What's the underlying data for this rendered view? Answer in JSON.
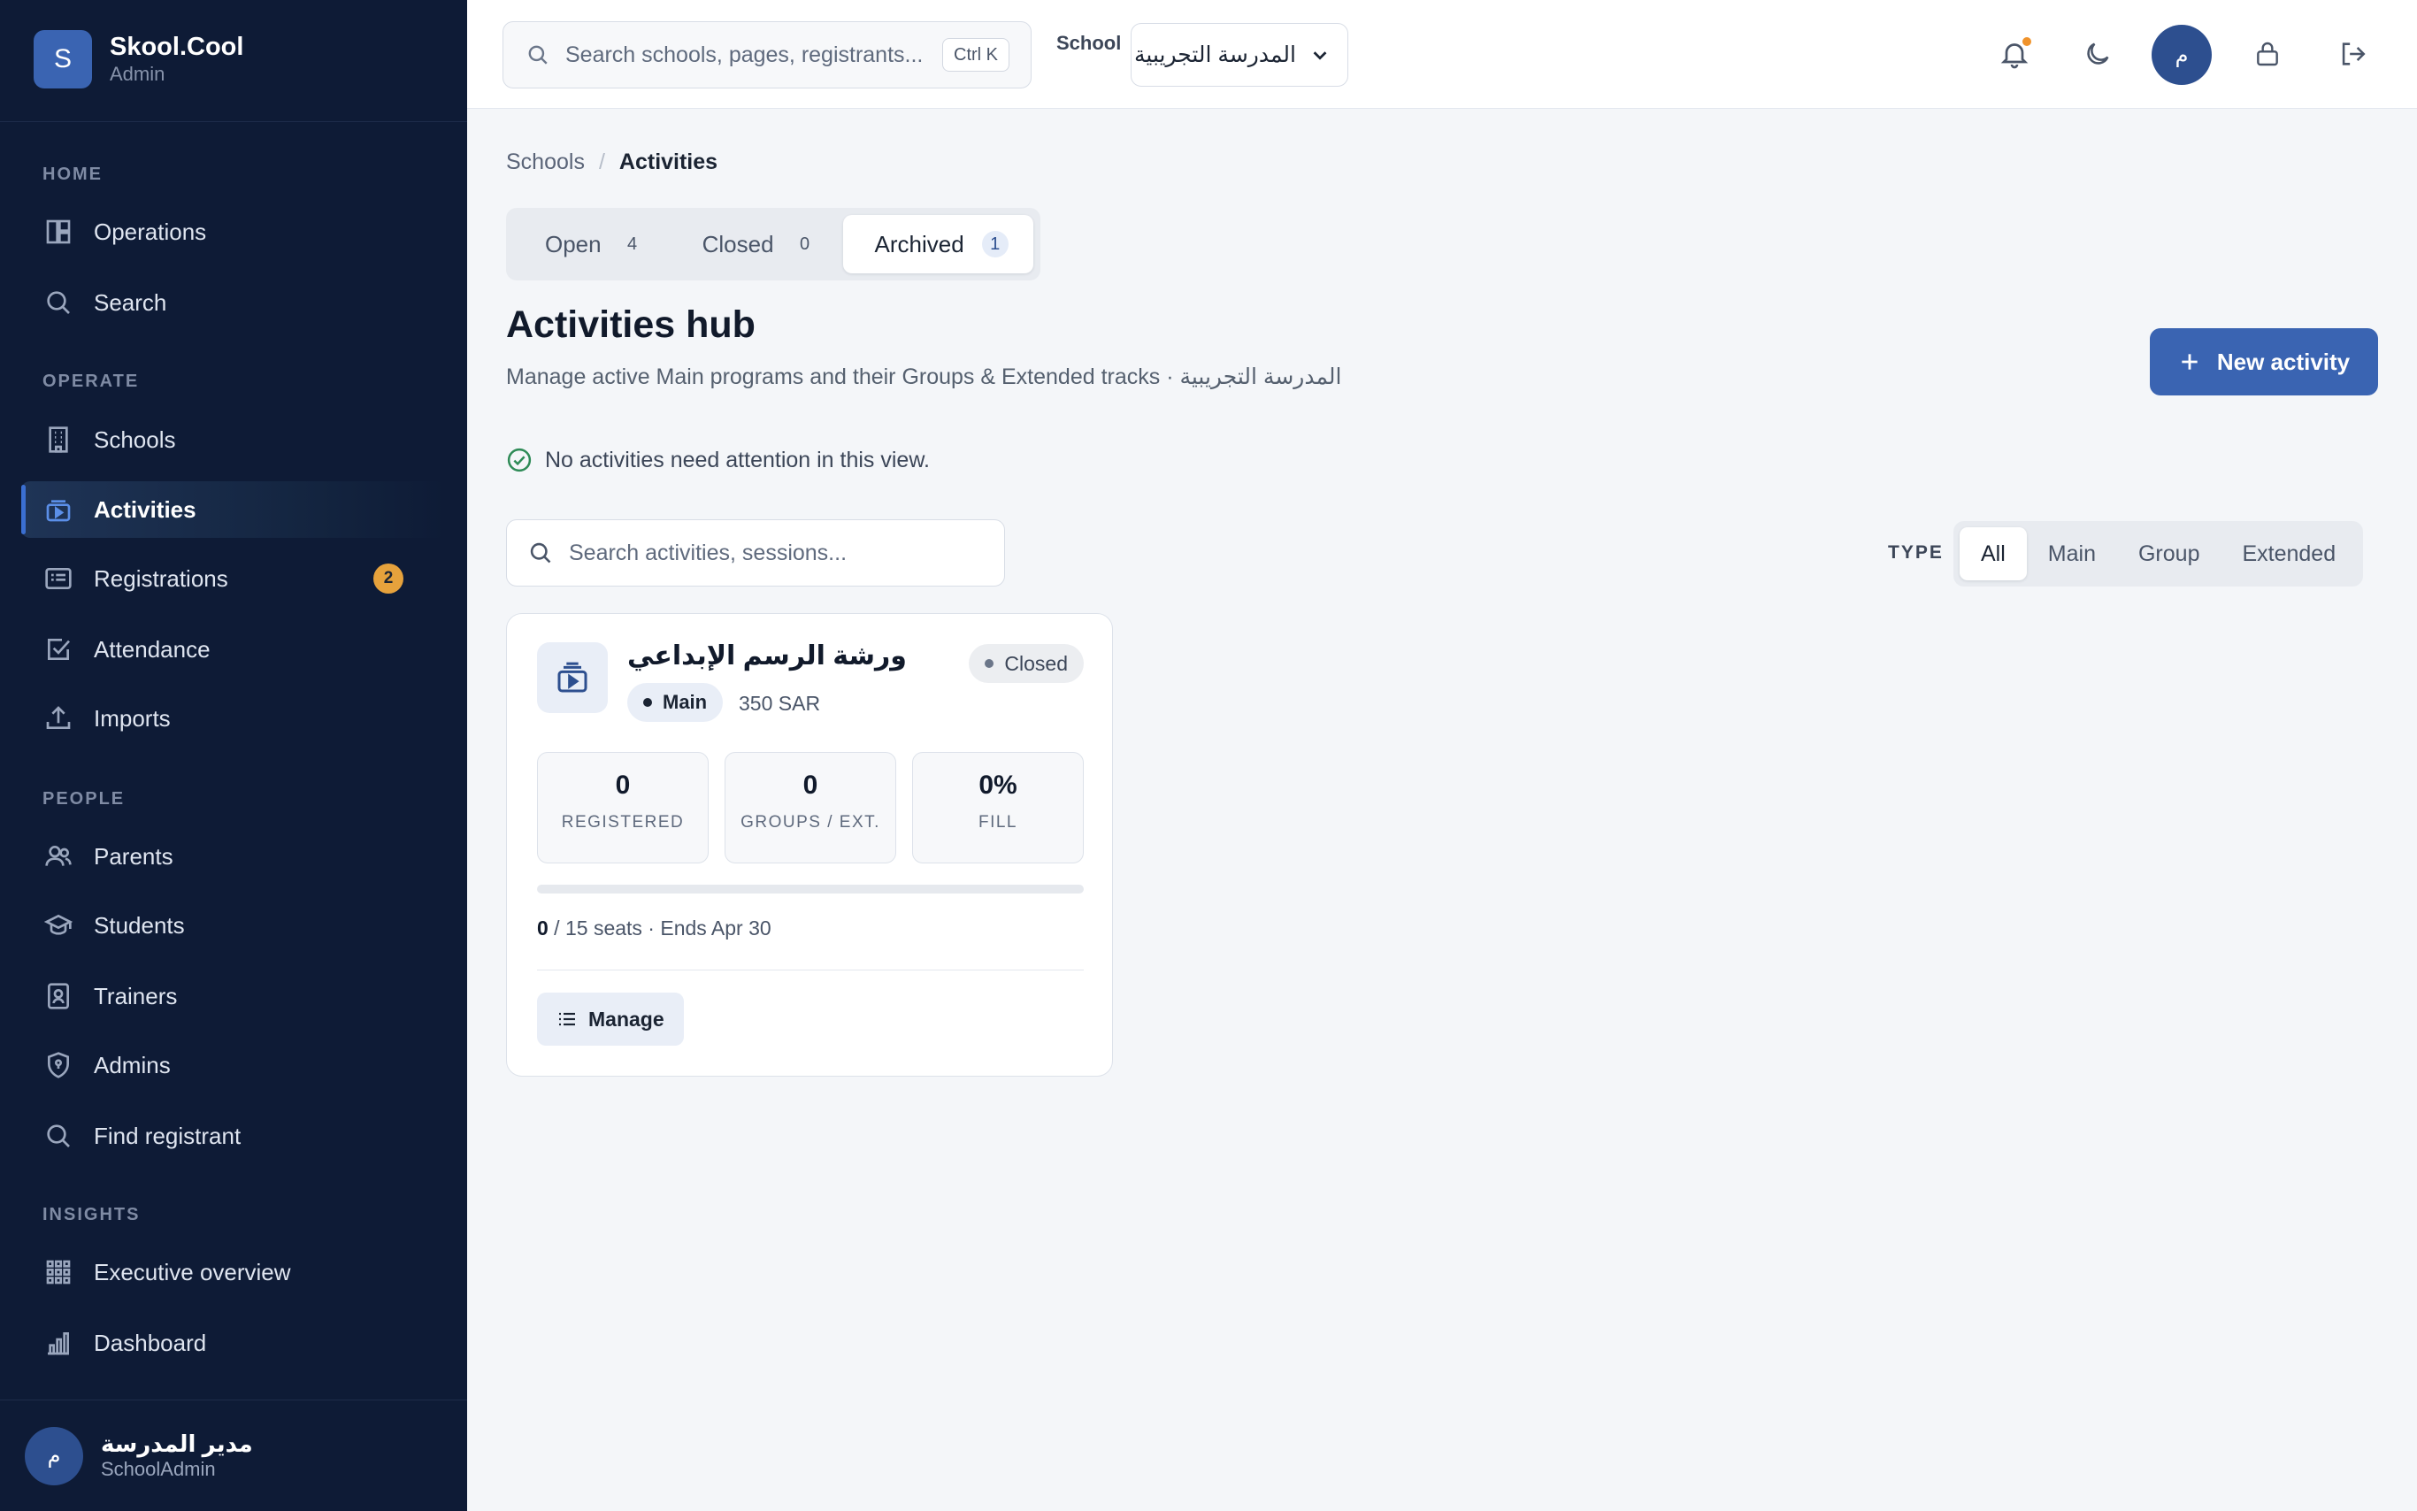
{
  "brand": {
    "logo_letter": "S",
    "name": "Skool.Cool",
    "role": "Admin"
  },
  "sidebar": {
    "sections": [
      "HOME",
      "OPERATE",
      "PEOPLE",
      "INSIGHTS"
    ],
    "items": [
      {
        "label": "Operations",
        "icon": "dashboard-icon"
      },
      {
        "label": "Search",
        "icon": "search-icon"
      },
      {
        "label": "Schools",
        "icon": "building-icon"
      },
      {
        "label": "Activities",
        "icon": "activity-icon",
        "active": true
      },
      {
        "label": "Registrations",
        "icon": "registration-card-icon",
        "badge": "2"
      },
      {
        "label": "Attendance",
        "icon": "checkbox-icon"
      },
      {
        "label": "Imports",
        "icon": "upload-icon"
      },
      {
        "label": "Parents",
        "icon": "users-icon"
      },
      {
        "label": "Students",
        "icon": "graduation-cap-icon"
      },
      {
        "label": "Trainers",
        "icon": "id-badge-icon"
      },
      {
        "label": "Admins",
        "icon": "shield-icon"
      },
      {
        "label": "Find registrant",
        "icon": "search-icon"
      },
      {
        "label": "Executive overview",
        "icon": "grid-icon"
      },
      {
        "label": "Dashboard",
        "icon": "bar-chart-icon"
      }
    ]
  },
  "user": {
    "avatar_letter": "م",
    "name": "مدير المدرسة",
    "role": "SchoolAdmin"
  },
  "topbar": {
    "search_placeholder": "Search schools, pages, registrants...",
    "shortcut": "Ctrl K",
    "school_label": "School",
    "school_value": "المدرسة التجريبية",
    "avatar_letter": "م",
    "icons": [
      "bell-icon",
      "moon-icon",
      "lock-icon",
      "logout-icon"
    ]
  },
  "breadcrumb": {
    "parent": "Schools",
    "current": "Activities"
  },
  "status_tabs": [
    {
      "label": "Open",
      "count": "4"
    },
    {
      "label": "Closed",
      "count": "0"
    },
    {
      "label": "Archived",
      "count": "1",
      "active": true
    }
  ],
  "page": {
    "title": "Activities hub",
    "subtitle": "Manage active Main programs and their Groups & Extended tracks · المدرسة التجريبية",
    "new_button": "New activity",
    "notice": "No activities need attention in this view."
  },
  "filters": {
    "search_placeholder": "Search activities, sessions...",
    "type_label": "TYPE",
    "type_options": [
      "All",
      "Main",
      "Group",
      "Extended"
    ],
    "type_selected": "All"
  },
  "activity_card": {
    "title": "ورشة الرسم الإبداعي",
    "status": "Closed",
    "type": "Main",
    "price": "350 SAR",
    "stats": [
      {
        "value": "0",
        "label": "REGISTERED"
      },
      {
        "value": "0",
        "label": "GROUPS / EXT."
      },
      {
        "value": "0%",
        "label": "FILL"
      }
    ],
    "fill_fraction": 0,
    "seats_taken": "0",
    "seats_rest": " / 15 seats · Ends Apr 30",
    "manage_label": "Manage"
  },
  "colors": {
    "sidebar_bg": "#0e1b36",
    "accent": "#3a64b2",
    "badge": "#e6a23c",
    "notice_check": "#2e8b57"
  }
}
